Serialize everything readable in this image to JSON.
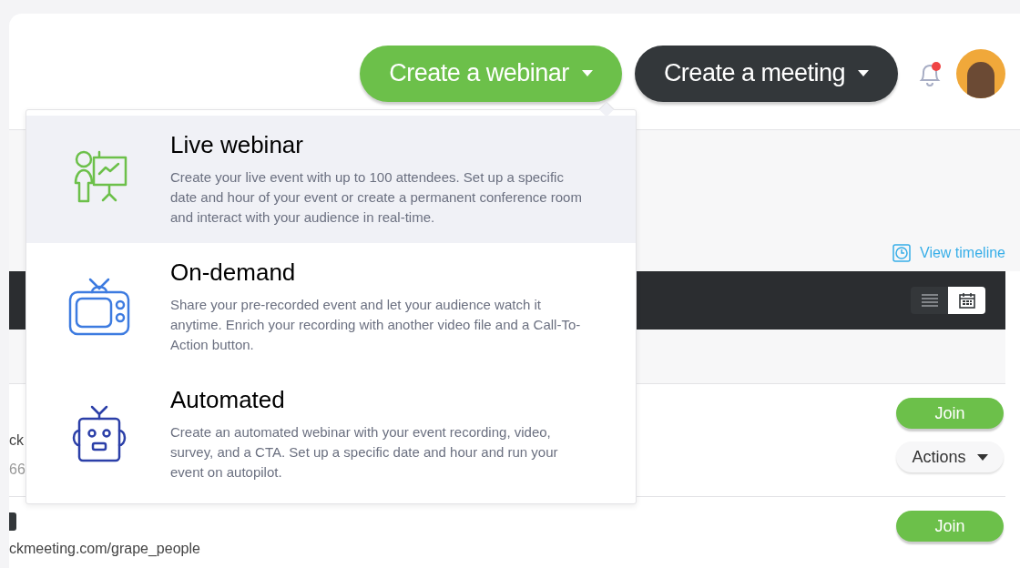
{
  "header": {
    "buttons": [
      {
        "kind": "primary",
        "label": "Create a webinar",
        "caret": true
      },
      {
        "kind": "dark",
        "label": "Create a meeting",
        "caret": true
      }
    ],
    "notifications": {
      "unread": true
    }
  },
  "webinar_menu": {
    "items": [
      {
        "kind": "live",
        "title": "Live webinar",
        "description": "Create your live event with up to 100 attendees. Set up a specific date and hour of your event or create a permanent conference room and interact with your audience in real-time.",
        "selected": true
      },
      {
        "kind": "tv",
        "title": "On-demand",
        "description": "Share your pre-recorded event and let your audience watch it anytime. Enrich your recording with another video file and a Call-To-Action button.",
        "selected": false
      },
      {
        "kind": "robot",
        "title": "Automated",
        "description": "Create an automated webinar with your event recording, video, survey, and a CTA. Set up a specific date and hour and run your event on autopilot.",
        "selected": false
      }
    ]
  },
  "view_timeline": "View timeline",
  "view_toggle": [
    {
      "kind": "list",
      "selected": false
    },
    {
      "kind": "calendar",
      "selected": true
    }
  ],
  "rows": [
    {
      "lines": [
        "ck",
        "66"
      ],
      "badge": false,
      "join": "Join",
      "actions": "Actions"
    },
    {
      "lines": [
        "ckmeeting.com/grape_people"
      ],
      "badge": true,
      "join": "Join"
    }
  ]
}
